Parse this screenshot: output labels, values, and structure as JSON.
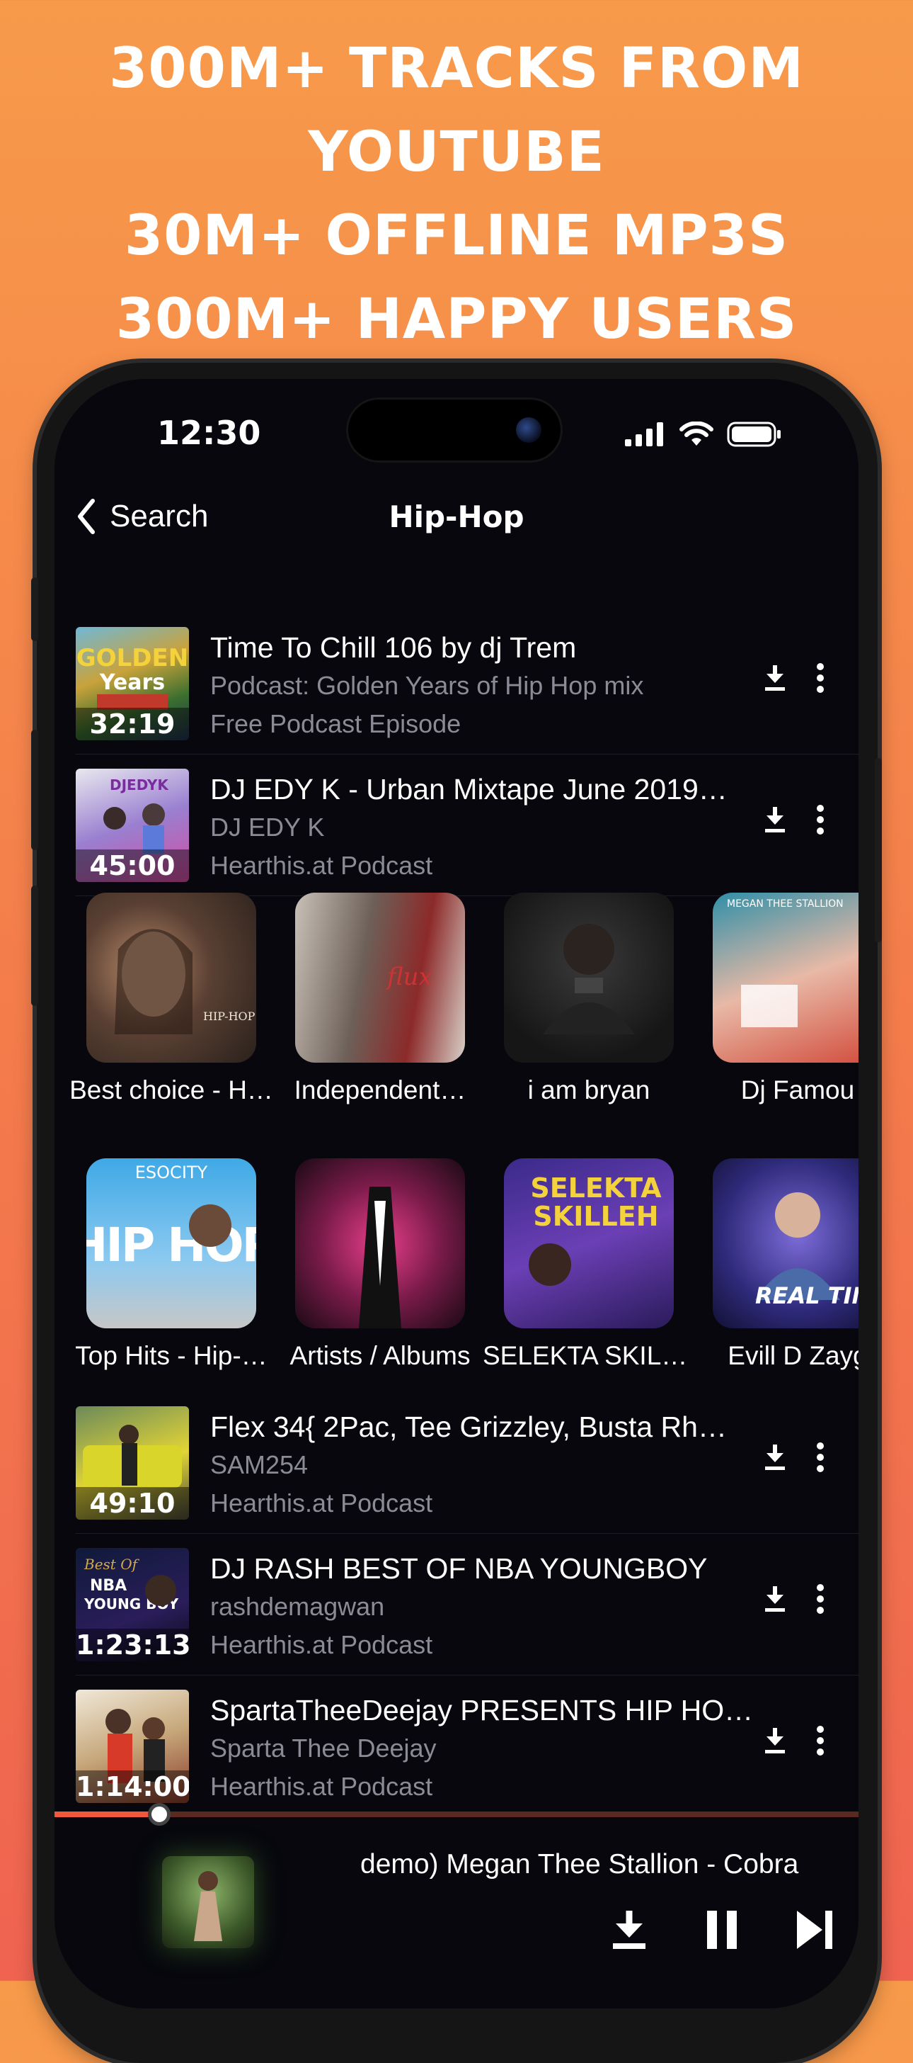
{
  "promo": {
    "line1": "300M+ TRACKS FROM",
    "line2": "YOUTUBE",
    "line3": "30M+ OFFLINE MP3S",
    "line4": "300M+ HAPPY USERS"
  },
  "status_bar": {
    "time": "12:30"
  },
  "nav": {
    "back_label": "Search",
    "title": "Hip-Hop"
  },
  "tracks_top": [
    {
      "title": "Time To Chill 106 by dj Trem",
      "subtitle": "Podcast: Golden Years of Hip Hop mix",
      "source": "Free Podcast Episode",
      "duration": "32:19"
    },
    {
      "title": "DJ EDY K - Urban Mixtape June 2019…",
      "subtitle": "DJ EDY K",
      "source": "Hearthis.at Podcast",
      "duration": "45:00"
    }
  ],
  "carousel_1": [
    {
      "label": "Best choice - H…"
    },
    {
      "label": "Independent…"
    },
    {
      "label": "i am bryan"
    },
    {
      "label": "Dj Famou"
    }
  ],
  "carousel_2": [
    {
      "label": "Top Hits - Hip-…"
    },
    {
      "label": "Artists / Albums"
    },
    {
      "label": "SELEKTA SKILL…"
    },
    {
      "label": "Evill D Zayg"
    }
  ],
  "tracks_bottom": [
    {
      "title": "Flex 34{ 2Pac, Tee Grizzley, Busta Rh…",
      "subtitle": "SAM254",
      "source": "Hearthis.at Podcast",
      "duration": "49:10"
    },
    {
      "title": "DJ RASH BEST OF NBA YOUNGBOY",
      "subtitle": "rashdemagwan",
      "source": "Hearthis.at Podcast",
      "duration": "1:23:13"
    },
    {
      "title": "SpartaTheeDeejay PRESENTS HIP HO…",
      "subtitle": "Sparta Thee Deejay",
      "source": "Hearthis.at Podcast",
      "duration": "1:14:00"
    }
  ],
  "player": {
    "now_playing": "demo) Megan Thee Stallion - Cobra (fan",
    "progress": 0.13
  },
  "icons": {
    "back": "chevron-left-icon",
    "download": "download-icon",
    "more": "more-vertical-icon",
    "pause": "pause-icon",
    "next": "skip-next-icon",
    "signal": "cellular-signal-icon",
    "wifi": "wifi-icon",
    "battery": "battery-icon"
  },
  "colors": {
    "accent": "#f2583c",
    "background": "#07070d",
    "muted_text": "#8b8b95"
  }
}
